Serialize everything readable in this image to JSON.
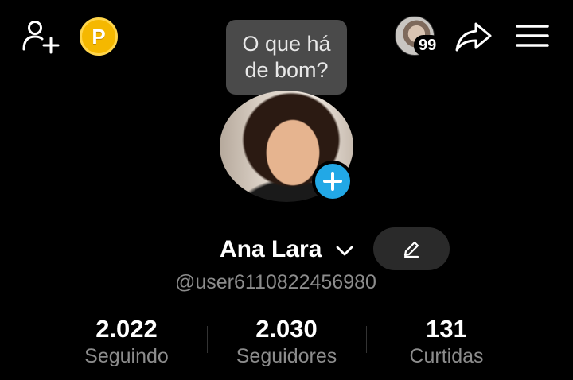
{
  "topbar": {
    "coin_letter": "P",
    "visitor_count": "99"
  },
  "tooltip": {
    "text": "O que há de bom?"
  },
  "profile": {
    "name": "Ana Lara",
    "username": "@user6110822456980"
  },
  "stats": [
    {
      "value": "2.022",
      "label": "Seguindo"
    },
    {
      "value": "2.030",
      "label": "Seguidores"
    },
    {
      "value": "131",
      "label": "Curtidas"
    }
  ],
  "colors": {
    "background": "#000000",
    "accent_blue": "#22a8e6",
    "coin_gold": "#f5b800",
    "secondary_text": "#8c8c8c",
    "bubble_bg": "#4a4a4a"
  },
  "icons": [
    "add-friend-icon",
    "coin-icon",
    "share-icon",
    "menu-icon",
    "plus-icon",
    "chevron-down-icon",
    "pencil-icon"
  ]
}
